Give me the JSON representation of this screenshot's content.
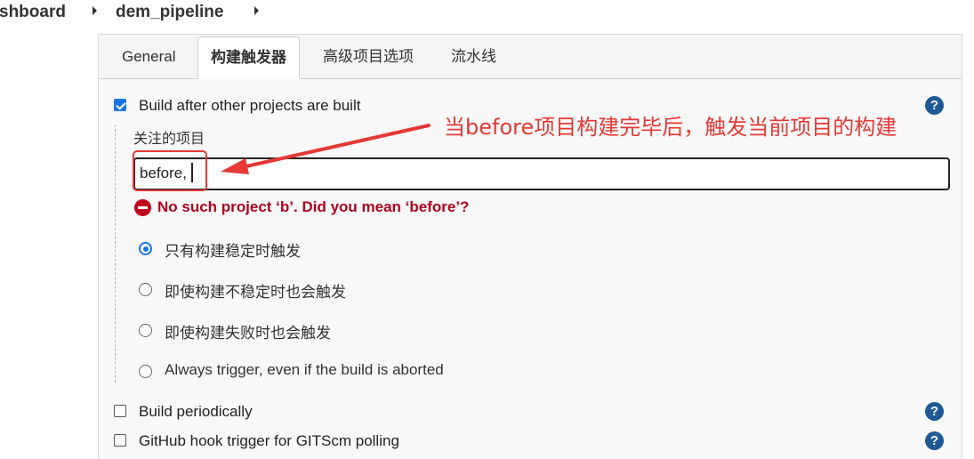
{
  "breadcrumb": {
    "items": [
      "shboard",
      "dem_pipeline"
    ]
  },
  "tabs": [
    {
      "label": "General",
      "active": false
    },
    {
      "label": "构建触发器",
      "active": true
    },
    {
      "label": "高级项目选项",
      "active": false
    },
    {
      "label": "流水线",
      "active": false
    }
  ],
  "trigger": {
    "build_after": {
      "label": "Build after other projects are built",
      "checked": true,
      "field_label": "关注的项目",
      "input_value": "before,",
      "error": "No such project ‘b’. Did you mean ‘before’?",
      "options": [
        {
          "label": "只有构建稳定时触发",
          "selected": true
        },
        {
          "label": "即使构建不稳定时也会触发",
          "selected": false
        },
        {
          "label": "即使构建失败时也会触发",
          "selected": false
        },
        {
          "label": "Always trigger, even if the build is aborted",
          "selected": false
        }
      ]
    },
    "build_periodically": {
      "label": "Build periodically",
      "checked": false
    },
    "github_hook": {
      "label": "GitHub hook trigger for GITScm polling",
      "checked": false
    }
  },
  "help_icon_glyph": "?",
  "annotation": {
    "text": "当before项目构建完毕后，触发当前项目的构建",
    "color": "#e53935"
  },
  "colors": {
    "accent": "#1a73e8",
    "error": "#b0001e",
    "help": "#1e5a96"
  }
}
